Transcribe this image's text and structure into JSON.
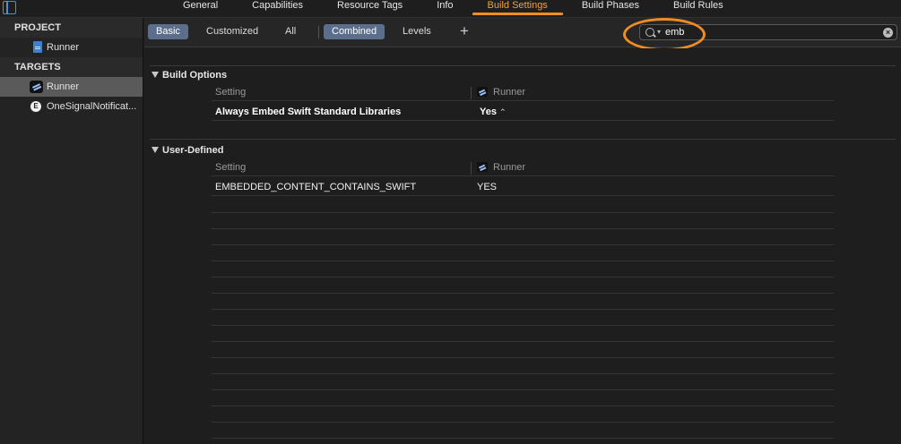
{
  "tabs": [
    {
      "label": "General"
    },
    {
      "label": "Capabilities"
    },
    {
      "label": "Resource Tags"
    },
    {
      "label": "Info"
    },
    {
      "label": "Build Settings"
    },
    {
      "label": "Build Phases"
    },
    {
      "label": "Build Rules"
    }
  ],
  "active_tab": "Build Settings",
  "sidebar": {
    "project_header": "PROJECT",
    "project_items": [
      {
        "label": "Runner",
        "icon": "project-file-icon"
      }
    ],
    "targets_header": "TARGETS",
    "target_items": [
      {
        "label": "Runner",
        "icon": "app-target-icon",
        "selected": true
      },
      {
        "label": "OneSignalNotificat...",
        "icon": "extension-target-icon",
        "selected": false
      }
    ]
  },
  "filter": {
    "basic": "Basic",
    "customized": "Customized",
    "all": "All",
    "combined": "Combined",
    "levels": "Levels",
    "add": "+",
    "search_value": "emb"
  },
  "groups": {
    "build_options": {
      "title": "Build Options",
      "header_setting": "Setting",
      "header_target": "Runner",
      "rows": [
        {
          "name": "Always Embed Swift Standard Libraries",
          "value": "Yes"
        }
      ]
    },
    "user_defined": {
      "title": "User-Defined",
      "header_setting": "Setting",
      "header_target": "Runner",
      "rows": [
        {
          "name": "EMBEDDED_CONTENT_CONTAINS_SWIFT",
          "value": "YES"
        }
      ]
    }
  },
  "colors": {
    "accent": "#f08c24",
    "selection": "#5b6f8c",
    "background": "#1e1e1e"
  }
}
